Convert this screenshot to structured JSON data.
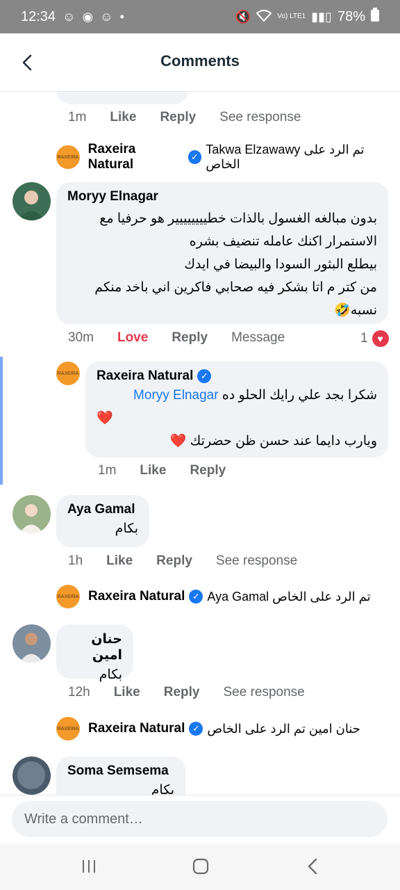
{
  "status_bar": {
    "time": "12:34",
    "battery": "78%",
    "network": "Vo) LTE1"
  },
  "header": {
    "title": "Comments"
  },
  "comments": [
    {
      "time": "1m",
      "actions": [
        "Like",
        "Reply",
        "See response"
      ]
    },
    {
      "auto_reply": {
        "author": "Raxeira Natural",
        "text": "Takwa Elzawawy تم الرد على الخاص"
      }
    },
    {
      "author": "Moryy Elnagar",
      "lines": [
        "بدون مبالغه الغسول بالذات خطيييييييير هو حرفيا مع",
        "الاستمرار اكنك عامله تنضيف بشره",
        "بيطلع البثور السودا والبيضا في ايدك",
        "من كتر م اتا بشكر فيه صحابي فاكرين اني باخد منكم",
        "نسبه🤣"
      ],
      "time": "30m",
      "reaction_label": "Love",
      "reply_label": "Reply",
      "message_label": "Message",
      "reaction_count": "1"
    },
    {
      "author": "Raxeira Natural",
      "mention": "Moryy Elnagar",
      "line1": "شكرا بجد علي رايك الحلو ده",
      "line2": "❤️",
      "line3": "ويارب دايما عند حسن ظن حضرتك ❤️",
      "time": "1m",
      "like": "Like",
      "reply": "Reply"
    },
    {
      "author": "Aya Gamal",
      "text": "بكام",
      "time": "1h",
      "actions": [
        "Like",
        "Reply",
        "See response"
      ],
      "auto_reply": {
        "author": "Raxeira Natural",
        "text": "Aya Gamal تم الرد على الخاص"
      }
    },
    {
      "author": "حنان امين",
      "text": "بكام",
      "time": "12h",
      "actions": [
        "Like",
        "Reply",
        "See response"
      ],
      "auto_reply": {
        "author": "Raxeira Natural",
        "text": "حنان امين تم الرد على الخاص"
      }
    },
    {
      "author": "Soma Semsema",
      "text": "بكام"
    }
  ],
  "composer": {
    "placeholder": "Write a comment…"
  },
  "colors": {
    "accent": "#1877f2",
    "love": "#e4384d",
    "bubble": "#f0f2f5",
    "thread_line": "#7aa7f7"
  }
}
